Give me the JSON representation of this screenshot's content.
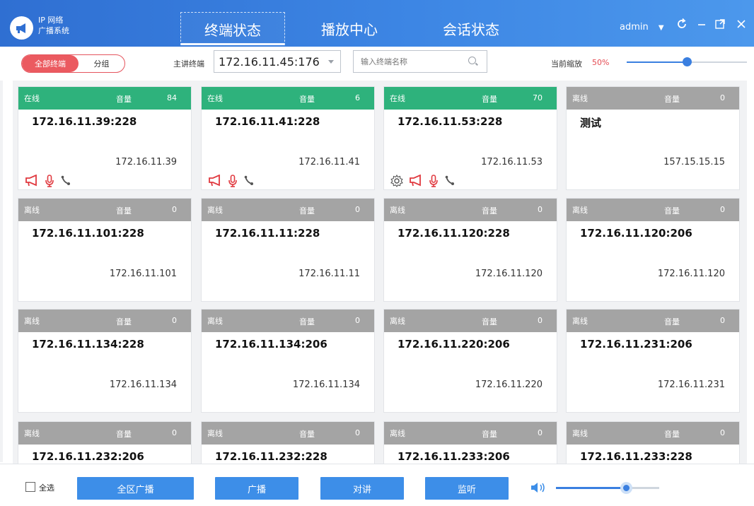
{
  "header": {
    "brand_line1": "IP 网络",
    "brand_line2": "广播系统",
    "tabs": [
      {
        "label": "终端状态",
        "active": true
      },
      {
        "label": "播放中心",
        "active": false
      },
      {
        "label": "会话状态",
        "active": false
      }
    ],
    "user": "admin",
    "icons": [
      "refresh-icon",
      "minimize-icon",
      "maximize-icon",
      "close-icon"
    ]
  },
  "toolbar": {
    "filter_all": "全部终端",
    "filter_group": "分组",
    "master_label": "主讲终端",
    "master_value": "172.16.11.45:176",
    "search_placeholder": "输入终端名称",
    "zoom_label": "当前缩放",
    "zoom_value": "50%",
    "zoom_fraction": 0.5
  },
  "cards": [
    {
      "status": "在线",
      "online": true,
      "vol_label": "音量",
      "volume": "84",
      "name": "172.16.11.39:228",
      "ip": "172.16.11.39",
      "icons": [
        "broadcast-icon",
        "microphone-icon",
        "intercom-icon"
      ]
    },
    {
      "status": "在线",
      "online": true,
      "vol_label": "音量",
      "volume": "6",
      "name": "172.16.11.41:228",
      "ip": "172.16.11.41",
      "icons": [
        "broadcast-icon",
        "microphone-icon",
        "intercom-icon"
      ]
    },
    {
      "status": "在线",
      "online": true,
      "vol_label": "音量",
      "volume": "70",
      "name": "172.16.11.53:228",
      "ip": "172.16.11.53",
      "icons": [
        "settings-icon",
        "broadcast-icon",
        "microphone-icon",
        "intercom-icon"
      ]
    },
    {
      "status": "离线",
      "online": false,
      "vol_label": "音量",
      "volume": "0",
      "name": "测试",
      "ip": "157.15.15.15",
      "icons": []
    },
    {
      "status": "离线",
      "online": false,
      "vol_label": "音量",
      "volume": "0",
      "name": "172.16.11.101:228",
      "ip": "172.16.11.101",
      "icons": []
    },
    {
      "status": "离线",
      "online": false,
      "vol_label": "音量",
      "volume": "0",
      "name": "172.16.11.11:228",
      "ip": "172.16.11.11",
      "icons": []
    },
    {
      "status": "离线",
      "online": false,
      "vol_label": "音量",
      "volume": "0",
      "name": "172.16.11.120:228",
      "ip": "172.16.11.120",
      "icons": []
    },
    {
      "status": "离线",
      "online": false,
      "vol_label": "音量",
      "volume": "0",
      "name": "172.16.11.120:206",
      "ip": "172.16.11.120",
      "icons": []
    },
    {
      "status": "离线",
      "online": false,
      "vol_label": "音量",
      "volume": "0",
      "name": "172.16.11.134:228",
      "ip": "172.16.11.134",
      "icons": []
    },
    {
      "status": "离线",
      "online": false,
      "vol_label": "音量",
      "volume": "0",
      "name": "172.16.11.134:206",
      "ip": "172.16.11.134",
      "icons": []
    },
    {
      "status": "离线",
      "online": false,
      "vol_label": "音量",
      "volume": "0",
      "name": "172.16.11.220:206",
      "ip": "172.16.11.220",
      "icons": []
    },
    {
      "status": "离线",
      "online": false,
      "vol_label": "音量",
      "volume": "0",
      "name": "172.16.11.231:206",
      "ip": "172.16.11.231",
      "icons": []
    },
    {
      "status": "离线",
      "online": false,
      "vol_label": "音量",
      "volume": "0",
      "name": "172.16.11.232:206",
      "ip": "",
      "icons": []
    },
    {
      "status": "离线",
      "online": false,
      "vol_label": "音量",
      "volume": "0",
      "name": "172.16.11.232:228",
      "ip": "",
      "icons": []
    },
    {
      "status": "离线",
      "online": false,
      "vol_label": "音量",
      "volume": "0",
      "name": "172.16.11.233:206",
      "ip": "",
      "icons": []
    },
    {
      "status": "离线",
      "online": false,
      "vol_label": "音量",
      "volume": "0",
      "name": "172.16.11.233:228",
      "ip": "",
      "icons": []
    }
  ],
  "footer": {
    "select_all": "全选",
    "buttons": [
      "全区广播",
      "广播",
      "对讲",
      "监听"
    ],
    "volume_fraction": 0.68
  },
  "colors": {
    "header": "#3d86e4",
    "online": "#2eb27c",
    "offline": "#a4a4a4",
    "accent_red": "#e5545d",
    "button_blue": "#3d8ee8"
  }
}
